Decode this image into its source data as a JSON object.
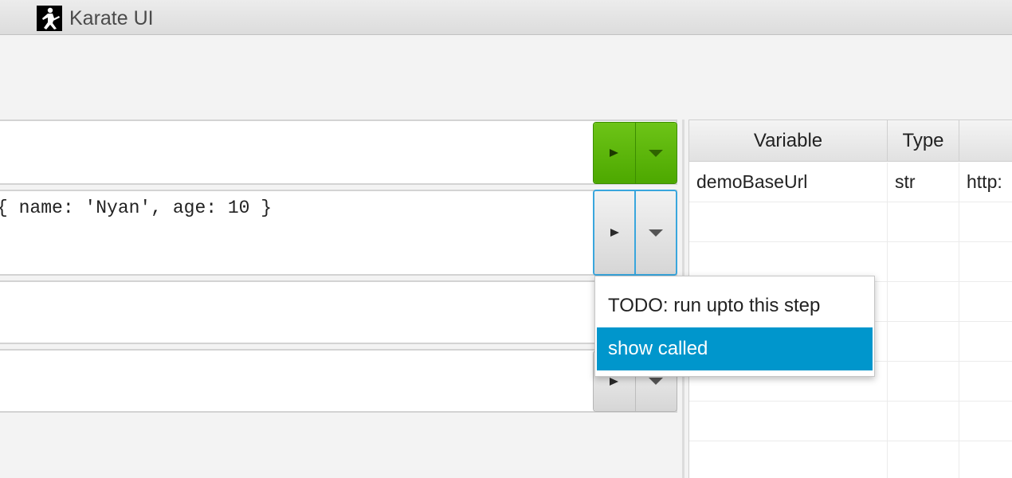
{
  "window": {
    "title": "Karate UI"
  },
  "steps": [
    {
      "text": ""
    },
    {
      "text": "{ name: 'Nyan', age: 10 }"
    },
    {
      "text": ""
    },
    {
      "text": ""
    }
  ],
  "buttons": {
    "run_icon": "play-icon",
    "menu_icon": "chevron-down-icon",
    "run_color": "#5bb70c",
    "focus_color": "#39a6dd"
  },
  "context_menu": {
    "items": [
      {
        "label": "TODO: run upto this step"
      },
      {
        "label": "show called",
        "selected": true
      }
    ],
    "selected_color": "#0096cc"
  },
  "variables": {
    "columns": [
      "Variable",
      "Type",
      ""
    ],
    "rows": [
      {
        "name": "demoBaseUrl",
        "type": "str",
        "value": "http:"
      }
    ]
  }
}
